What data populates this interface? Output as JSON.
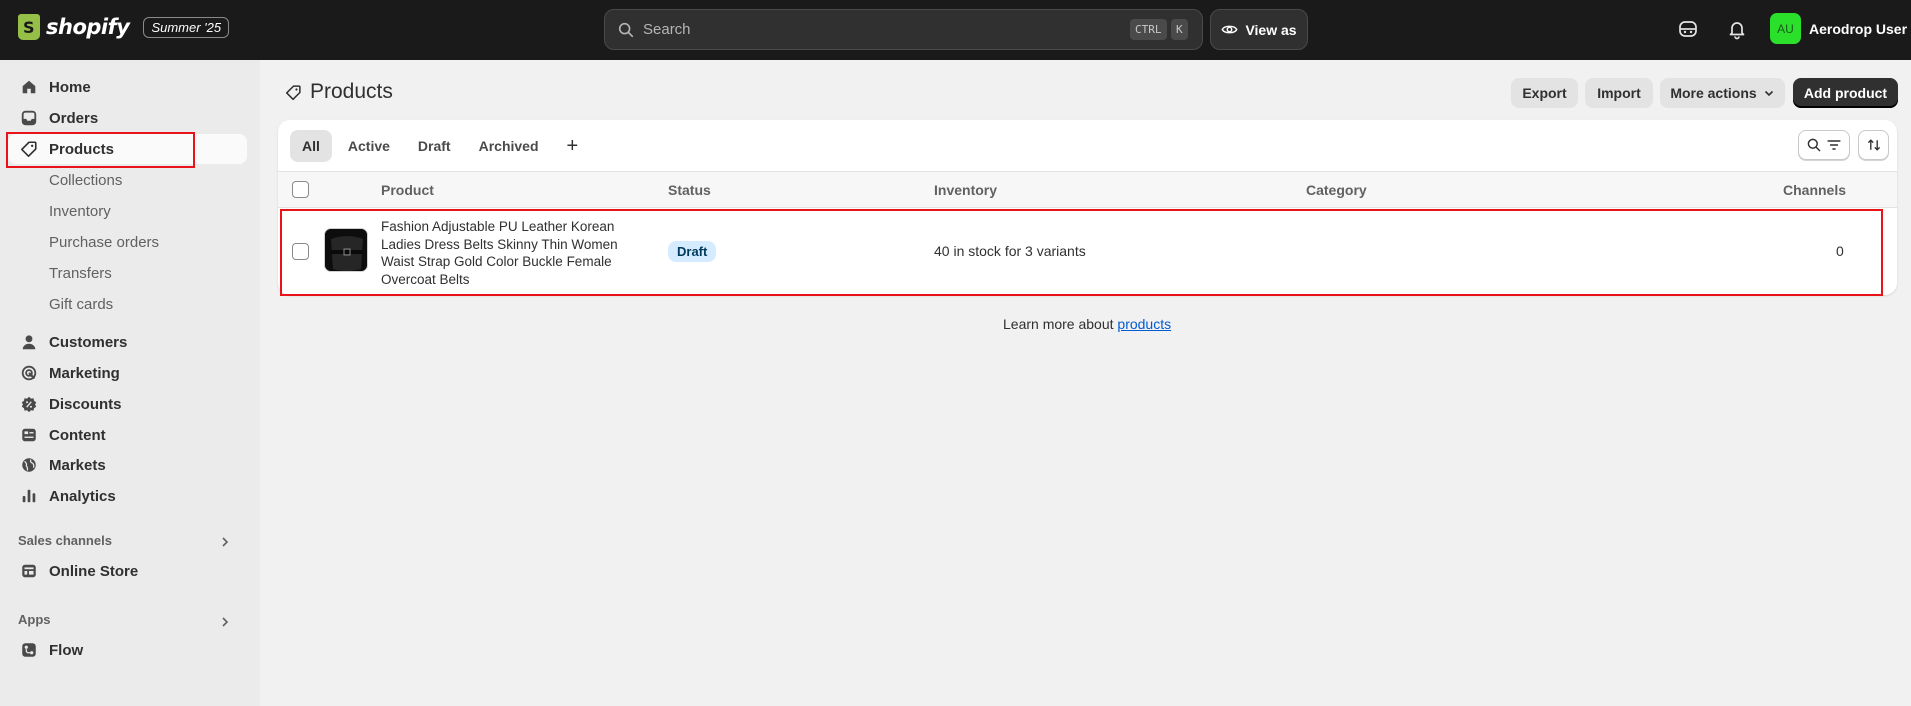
{
  "topbar": {
    "logo_text": "shopify",
    "edition": "Summer '25",
    "search_placeholder": "Search",
    "kbd_ctrl": "CTRL",
    "kbd_k": "K",
    "view_as": "View as",
    "user_initials": "AU",
    "user_name": "Aerodrop User"
  },
  "sidebar": {
    "items": [
      {
        "label": "Home",
        "icon": "home-icon"
      },
      {
        "label": "Orders",
        "icon": "inbox-icon"
      },
      {
        "label": "Products",
        "icon": "tag-icon"
      },
      {
        "label": "Customers",
        "icon": "person-icon"
      },
      {
        "label": "Marketing",
        "icon": "target-icon"
      },
      {
        "label": "Discounts",
        "icon": "discount-icon"
      },
      {
        "label": "Content",
        "icon": "content-icon"
      },
      {
        "label": "Markets",
        "icon": "globe-icon"
      },
      {
        "label": "Analytics",
        "icon": "bar-chart-icon"
      }
    ],
    "product_sub": [
      "Collections",
      "Inventory",
      "Purchase orders",
      "Transfers",
      "Gift cards"
    ],
    "sales_channels_label": "Sales channels",
    "online_store": "Online Store",
    "apps_label": "Apps",
    "flow": "Flow"
  },
  "page": {
    "title": "Products",
    "export": "Export",
    "import": "Import",
    "more_actions": "More actions",
    "add_product": "Add product"
  },
  "tabs": [
    "All",
    "Active",
    "Draft",
    "Archived"
  ],
  "tab_add": "+",
  "table": {
    "headers": {
      "product": "Product",
      "status": "Status",
      "inventory": "Inventory",
      "category": "Category",
      "channels": "Channels"
    },
    "rows": [
      {
        "product": "Fashion Adjustable PU Leather Korean Ladies Dress Belts Skinny Thin Women Waist Strap Gold Color Buckle Female Overcoat Belts",
        "status": "Draft",
        "inventory": "40 in stock for 3 variants",
        "category": "",
        "channels": "0"
      }
    ]
  },
  "footer": {
    "learn_prefix": "Learn more about ",
    "learn_link": "products"
  },
  "colors": {
    "topbar": "#1a1a1a",
    "highlight": "#e8141a",
    "badge_bg": "#d5ebff",
    "link": "#005bd3",
    "avatar": "#2be02b"
  }
}
